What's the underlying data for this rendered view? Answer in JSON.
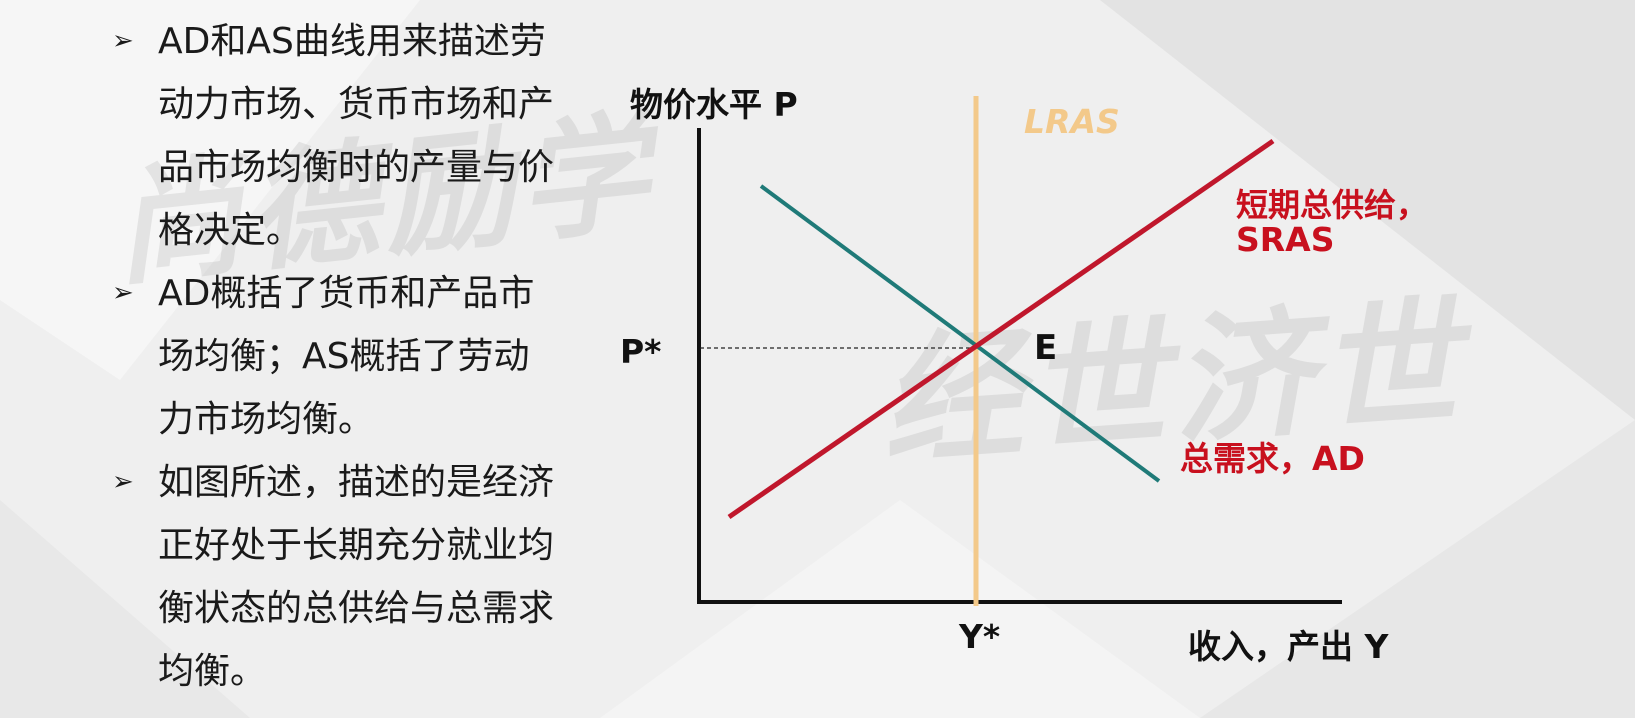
{
  "bullets": [
    {
      "lines": [
        "AD和AS曲线用来描述劳",
        "动力市场、货币市场和产",
        "品市场均衡时的产量与价",
        "格决定。"
      ]
    },
    {
      "lines": [
        "AD概括了货币和产品市",
        "场均衡；AS概括了劳动",
        "力市场均衡。"
      ]
    },
    {
      "lines": [
        "如图所述，描述的是经济",
        "正好处于长期充分就业均",
        "衡状态的总供给与总需求",
        "均衡。"
      ]
    }
  ],
  "diagram": {
    "y_axis_label": "物价水平 P",
    "x_axis_label": "收入，产出 Y",
    "price_label": "P*",
    "output_label": "Y*",
    "equilibrium_label": "E",
    "lras_label": "LRAS",
    "sras_label_line1": "短期总供给，",
    "sras_label_line2": "SRAS",
    "ad_label": "总需求，AD"
  },
  "watermarks": [
    "尚德励学",
    "经世济世"
  ],
  "colors": {
    "lras": "#f3c98a",
    "sras": "#c0172c",
    "ad": "#1f7a78",
    "axis": "#111111",
    "label_red": "#c8101e"
  }
}
